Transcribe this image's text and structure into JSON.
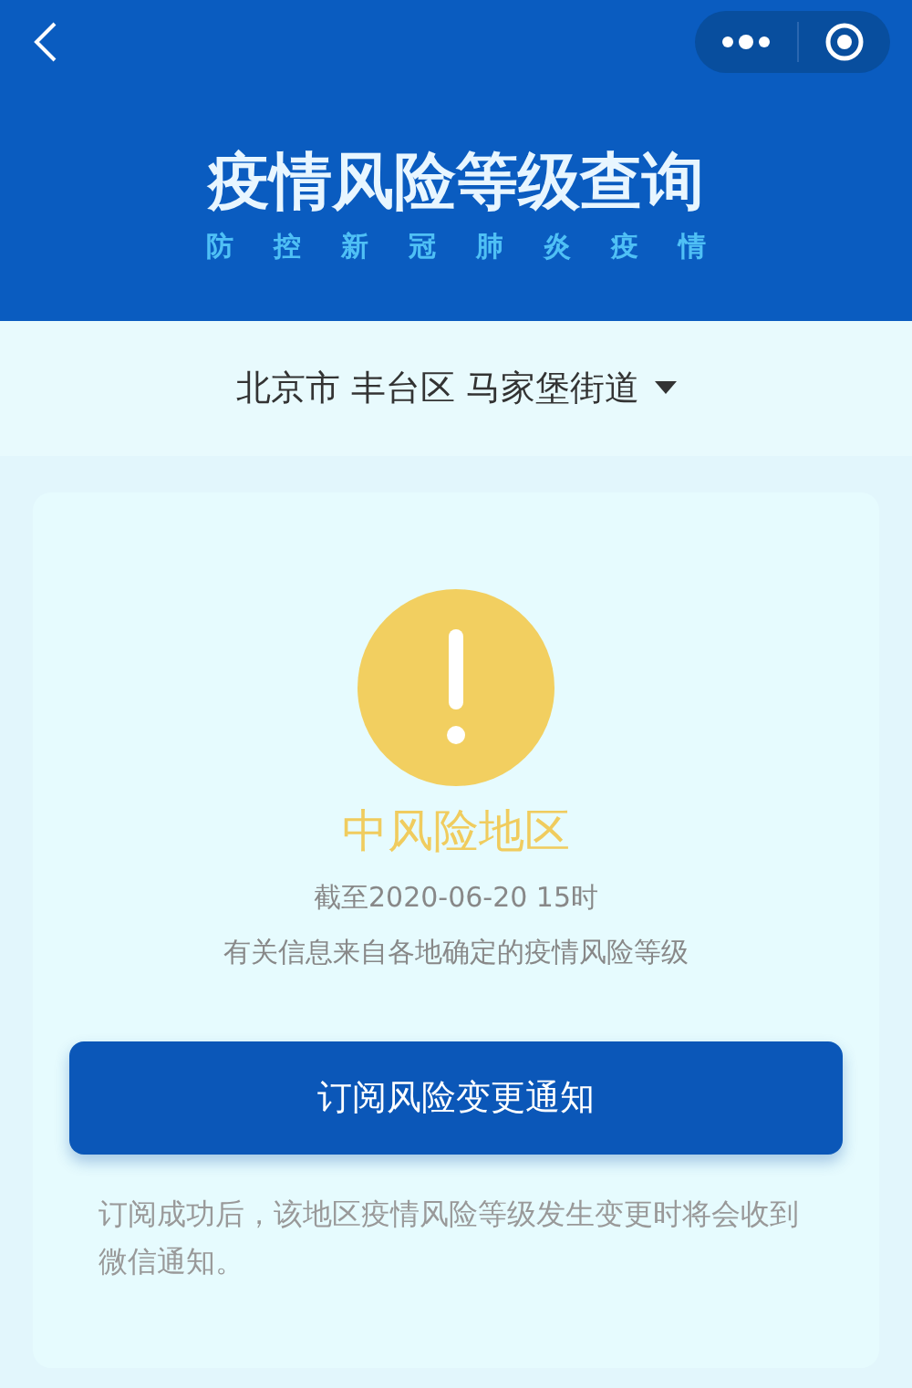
{
  "header": {
    "title": "疫情风险等级查询",
    "subtitle": [
      "防",
      "控",
      "新",
      "冠",
      "肺",
      "炎",
      "疫",
      "情"
    ]
  },
  "region": {
    "label": "北京市 丰台区 马家堡街道"
  },
  "result": {
    "kind": "medium",
    "level_text": "中风险地区",
    "date": "截至2020-06-20 15时",
    "source": "有关信息来自各地确定的疫情风险等级"
  },
  "subscribe_button": "订阅风险变更通知",
  "note": "订阅成功后，该地区疫情风险等级发生变更时将会收到微信通知。"
}
